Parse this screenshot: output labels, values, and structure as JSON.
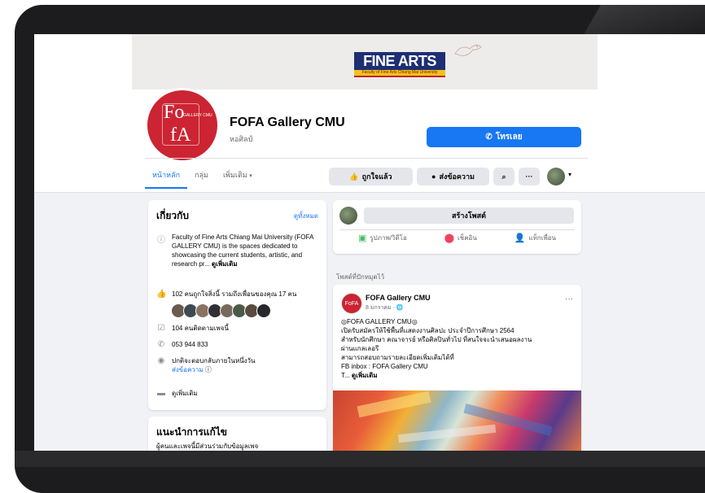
{
  "cover": {
    "logo_word_1": "FINE",
    "logo_word_2": "ARTS",
    "logo_subtitle": "Faculty of Fine Arts Chiang Mai University"
  },
  "profile": {
    "avatar_line_1": "Fo",
    "avatar_line_2": "fA",
    "avatar_small": "GALLERY CMU",
    "name": "FOFA Gallery CMU",
    "category": "หอศิลป์",
    "call_button": "โทรเลย"
  },
  "tabs": [
    {
      "label": "หน้าหลัก",
      "active": true
    },
    {
      "label": "กลุ่ม",
      "active": false
    },
    {
      "label": "เพิ่มเติม",
      "active": false
    }
  ],
  "tabs_caret": "▾",
  "actions": {
    "like_label": "ถูกใจแล้ว",
    "message_label": "ส่งข้อความ",
    "search_icon": "⌕",
    "more_icon": "···",
    "caret": "▾"
  },
  "about": {
    "title": "เกี่ยวกับ",
    "edit_link": "ดูทั้งหมด",
    "description": "Faculty of Fine Arts Chiang Mai University (FOFA GALLERY CMU) is the spaces dedicated to showcasing the current students, artistic, and research pr...",
    "description_more": "ดูเพิ่มเติม",
    "likes_text": "102 คนถูกใจสิ่งนี้ รวมถึงเพื่อนของคุณ 17 คน",
    "followers_text": "104 คนติดตามเพจนี้",
    "phone": "053 944 833",
    "response_text": "ปกติจะตอบกลับภายในหนึ่งวัน",
    "response_link": "ส่งข้อความ",
    "more_label": "ดูเพิ่มเติม"
  },
  "recommend": {
    "title": "แนะนำการแก้ไข",
    "text": "ผู้คนและเพจนี้มีส่วนร่วมกับข้อมูลเพจ"
  },
  "composer": {
    "create_post": "สร้างโพสต์",
    "photo_label": "รูปภาพ/วิดีโอ",
    "checkin_label": "เช็คอิน",
    "tag_label": "แท็กเพื่อน"
  },
  "pinned_label": "โพสต์ที่ปักหมุดไว้",
  "post": {
    "avatar_text": "FoFA",
    "name": "FOFA Gallery CMU",
    "date": "8 มกราคม · 🌐",
    "more": "···",
    "line_1": "◎FOFA GALLERY CMU◎",
    "line_2": "เปิดรับสมัครให้ใช้พื้นที่แสดงงานศิลปะ ประจำปีการศึกษา 2564",
    "line_3": "สำหรับนักศึกษา คณาจารย์ หรือศิลปินทั่วไป ที่สนใจจะนำเสนอผลงาน",
    "line_4": "ผ่านแกลเลอรี",
    "line_5": "สามารถสอบถามรายละเอียดเพิ่มเติมได้ที่",
    "line_6": "FB inbox : FOFA Gallery CMU",
    "line_7_prefix": "T...",
    "line_7_more": "ดูเพิ่มเติม"
  },
  "colors": {
    "accent": "#1877f2",
    "brand_red": "#cc2432",
    "background": "#f0f2f5"
  }
}
